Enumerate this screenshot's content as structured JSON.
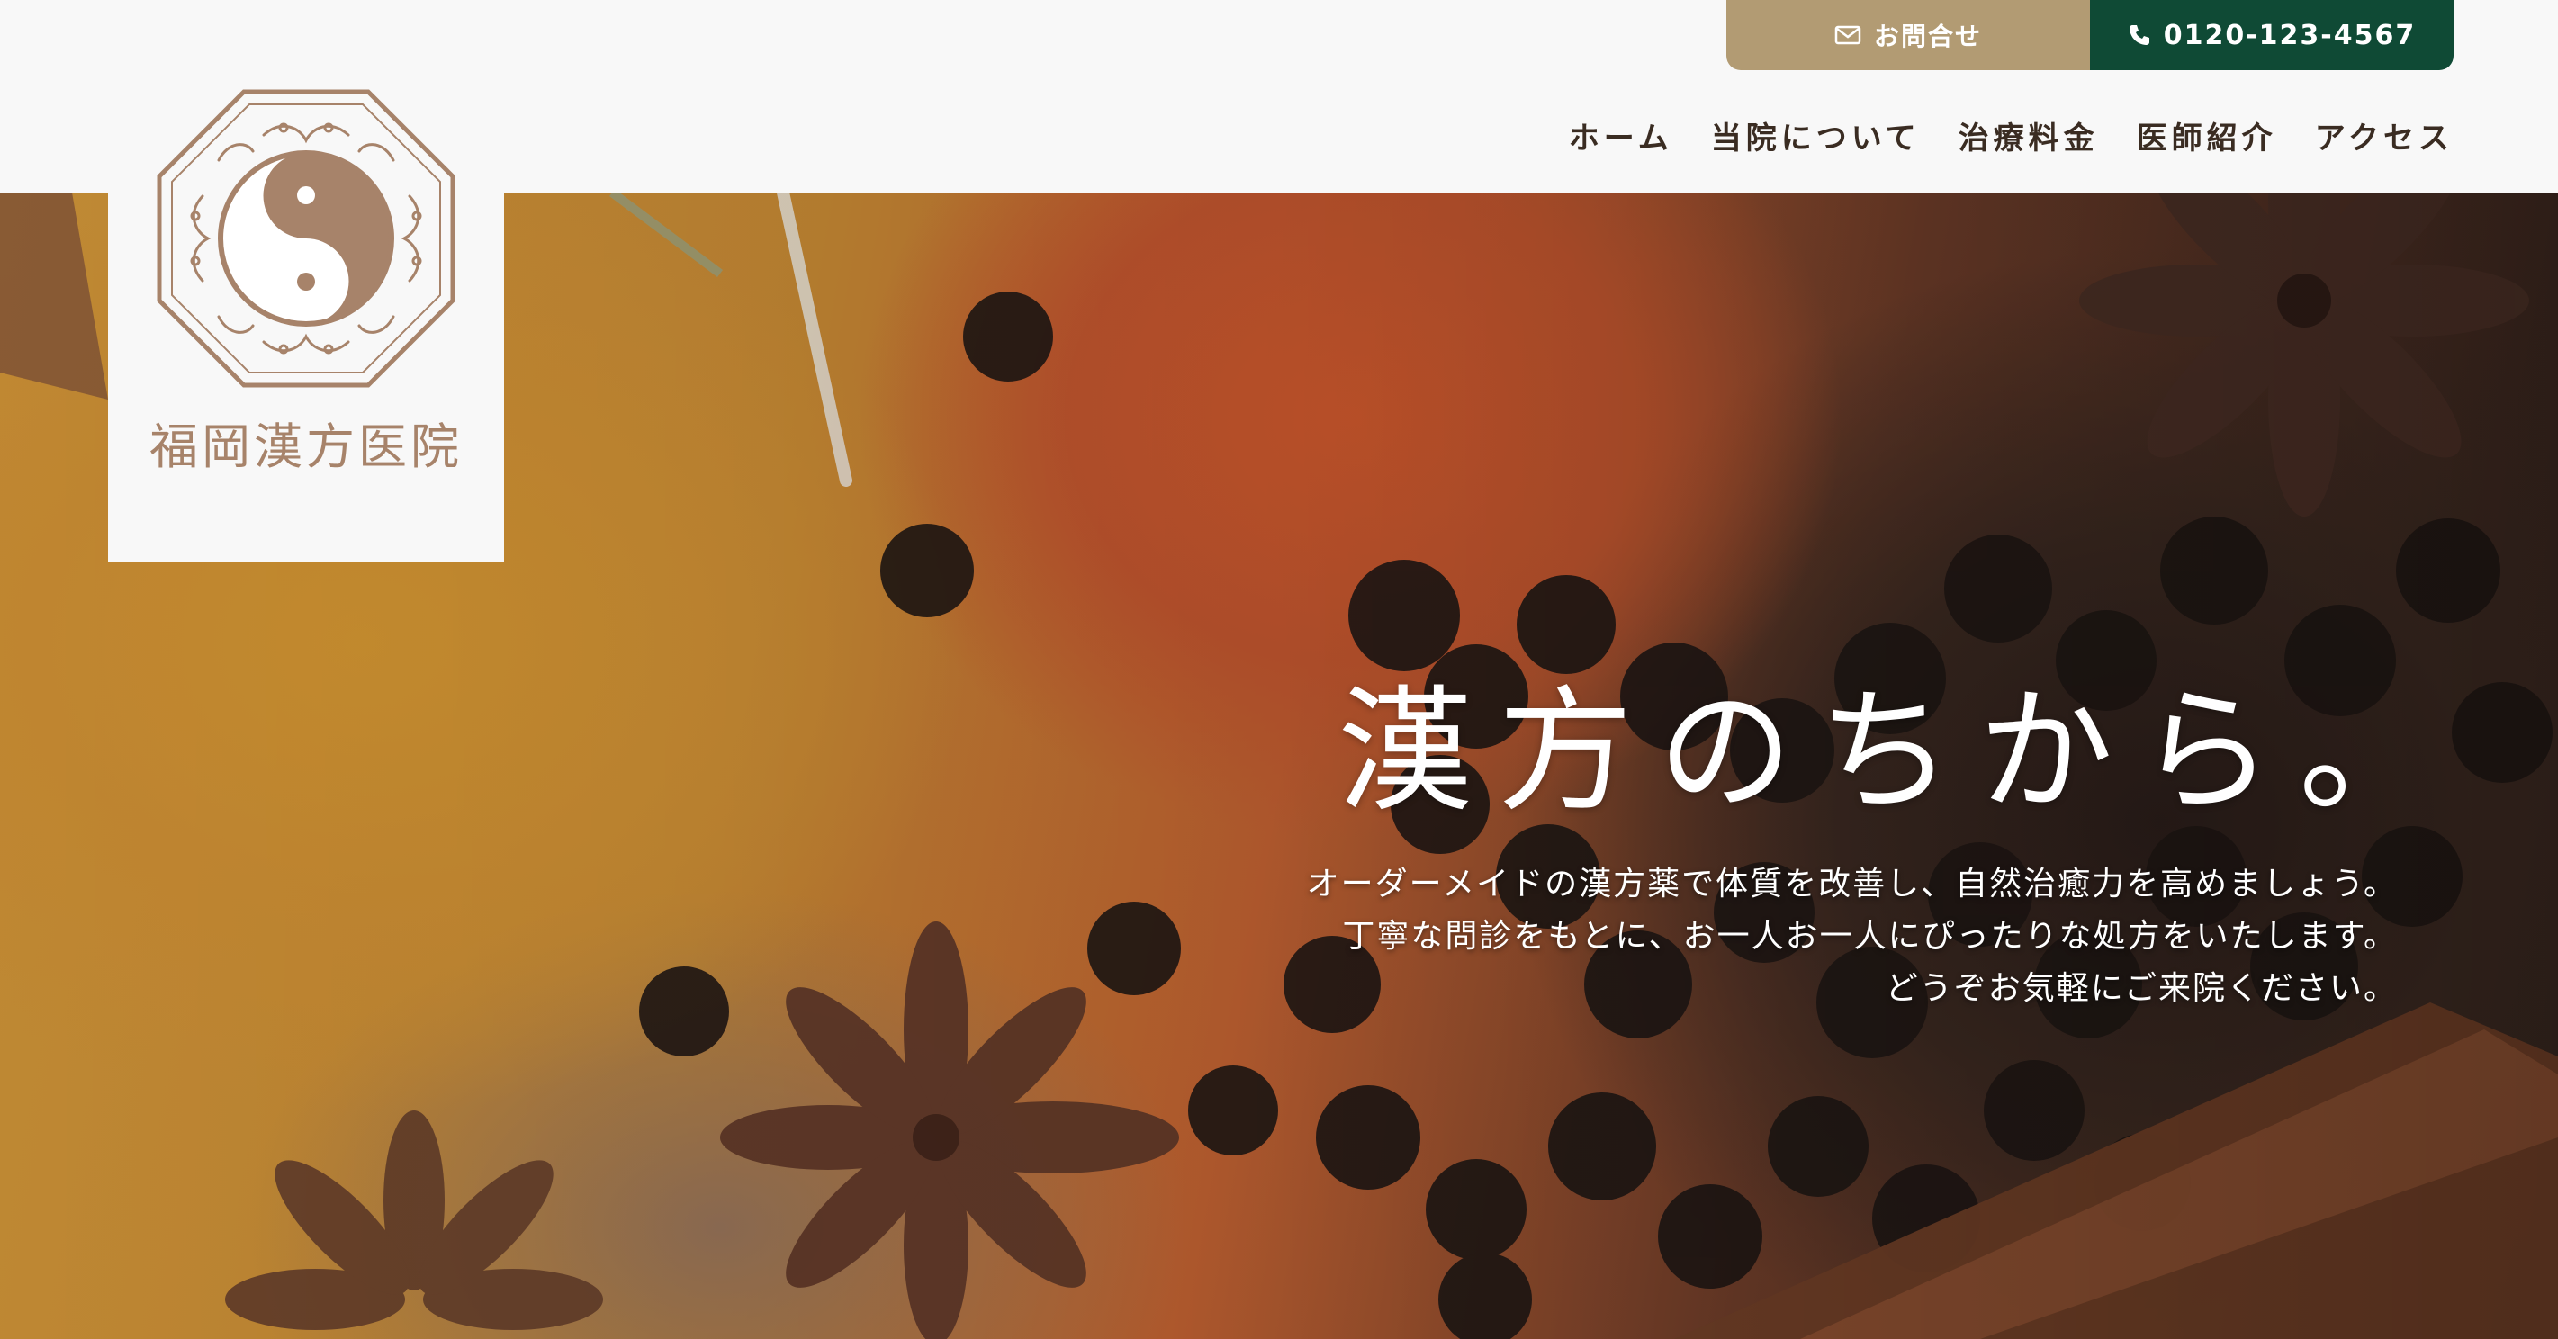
{
  "header": {
    "contact_label": "お問合せ",
    "contact_icon": "envelope-icon",
    "phone_label": "0120-123-4567",
    "phone_icon": "phone-icon",
    "colors": {
      "contact_bg": "#b29b73",
      "phone_bg": "#0f4a35",
      "nav_text": "#3a2c22"
    }
  },
  "nav": {
    "items": [
      {
        "label": "ホーム"
      },
      {
        "label": "当院について"
      },
      {
        "label": "治療料金"
      },
      {
        "label": "医師紹介"
      },
      {
        "label": "アクセス"
      }
    ]
  },
  "logo": {
    "name": "福岡漢方医院",
    "icon": "yin-yang-octagon-logo",
    "color": "#a7836a"
  },
  "hero": {
    "title": "漢方のちから。",
    "lines": [
      "オーダーメイドの漢方薬で体質を改善し、自然治癒力を高めましょう。",
      "丁寧な問診をもとに、お一人お一人にぴったりな処方をいたします。",
      "どうぞお気軽にご来院ください。"
    ]
  }
}
